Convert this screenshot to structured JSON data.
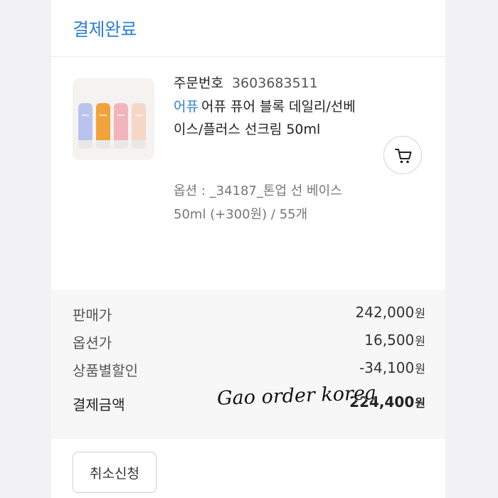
{
  "header": {
    "status_title": "결제완료"
  },
  "order": {
    "number_label": "주문번호",
    "number": "3603683511",
    "brand": "어퓨",
    "product_name": "어퓨 퓨어 블록 데일리/선베이스/플러스 선크림 50ml",
    "option": "옵션 : _34187_톤업 선 베이스50ml (+300원) / 55개",
    "cart_icon": "cart-icon"
  },
  "prices": {
    "rows": [
      {
        "label": "판매가",
        "value": "242,000",
        "unit": "원"
      },
      {
        "label": "옵션가",
        "value": "16,500",
        "unit": "원"
      },
      {
        "label": "상품별할인",
        "value": "-34,100",
        "unit": "원"
      },
      {
        "label": "결제금액",
        "value": "224,400",
        "unit": "원"
      }
    ]
  },
  "watermark": "Gao order korea",
  "actions": {
    "cancel_label": "취소신청"
  },
  "colors": {
    "accent": "#2f7fd3",
    "background": "#f2f2f4",
    "card": "#ffffff",
    "price_box": "#f7f7f8"
  }
}
